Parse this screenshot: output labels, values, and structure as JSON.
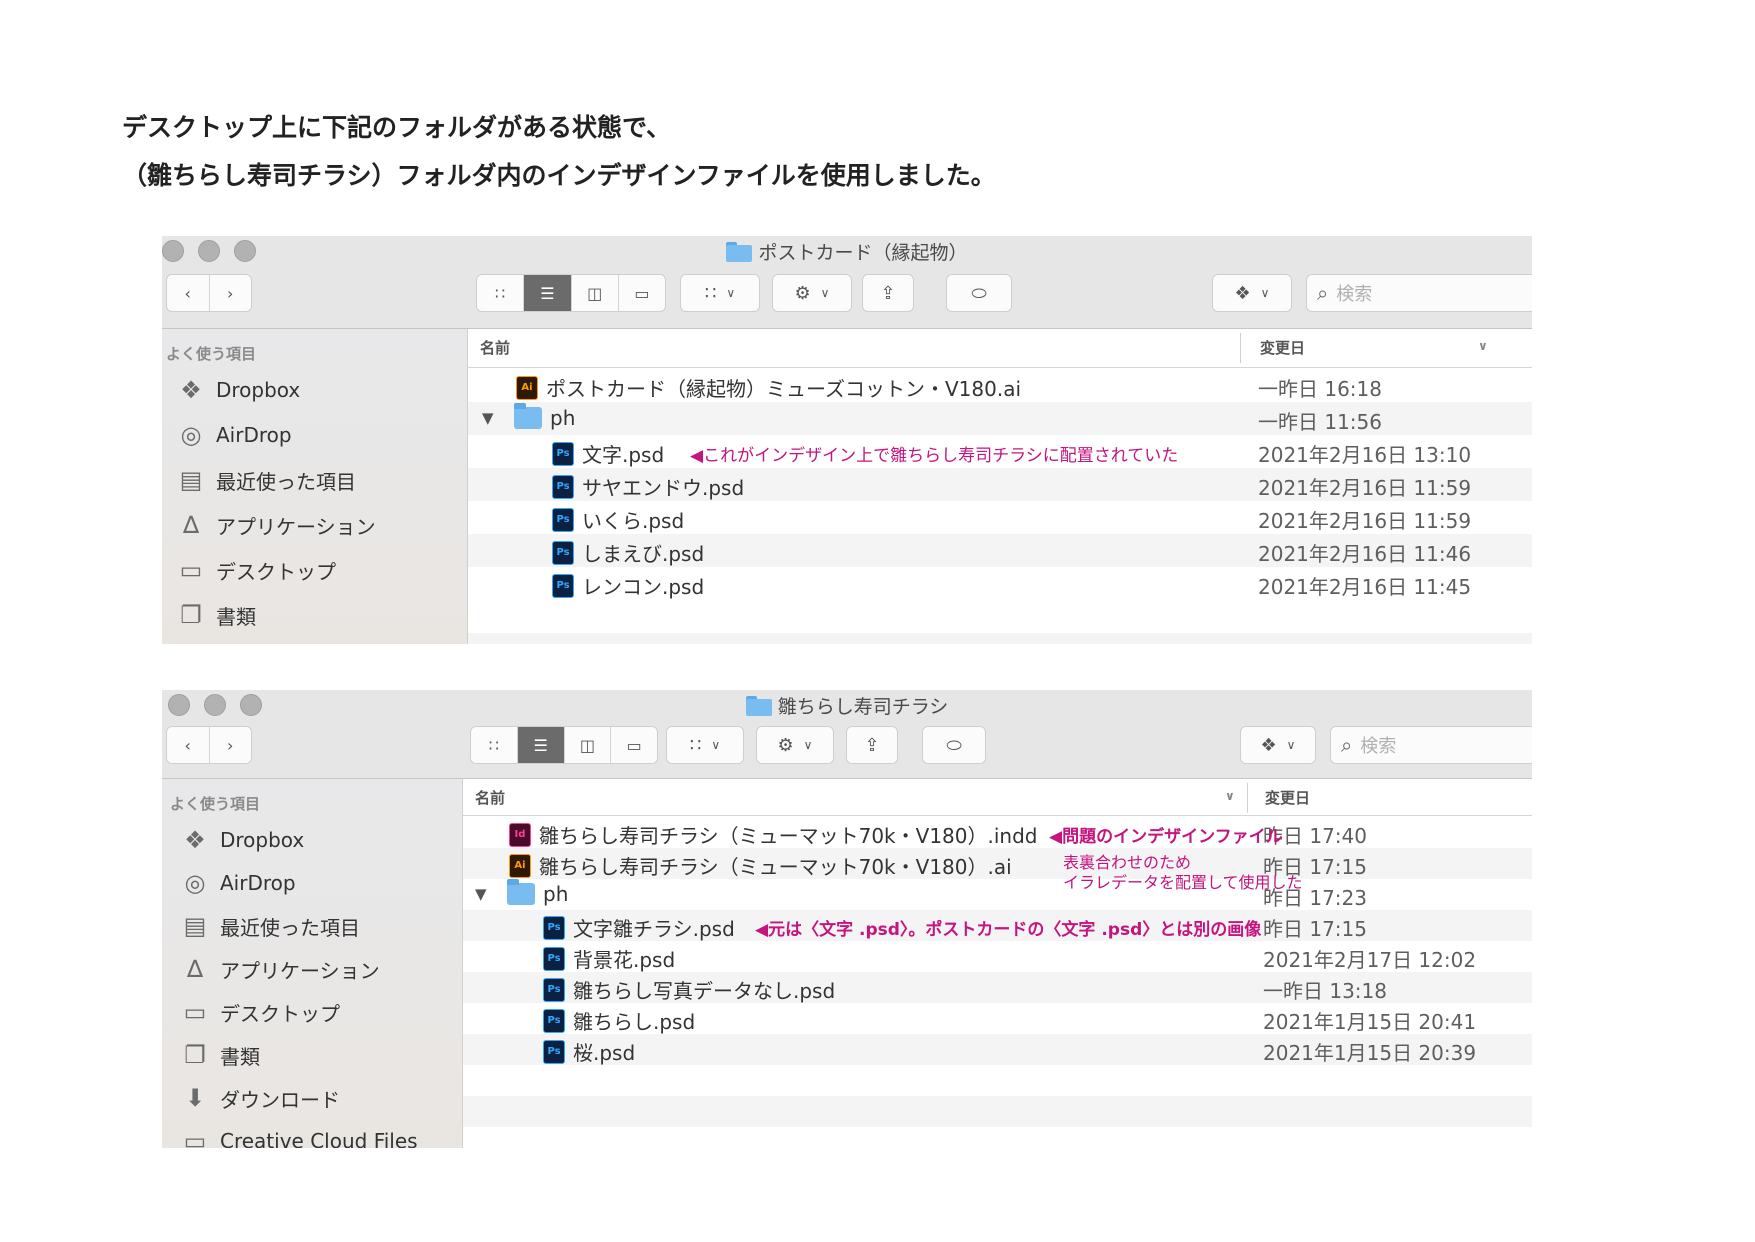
{
  "intro": {
    "line1": "デスクトップ上に下記のフォルダがある状態で、",
    "line2": "（雛ちらし寿司チラシ）フォルダ内のインデザインファイルを使用しました。"
  },
  "colors": {
    "annotation": "#c4147f",
    "folder": "#79bdf0",
    "selected_segment": "#6b6b6b"
  },
  "window1": {
    "title": "ポストカード（縁起物）",
    "search_placeholder": "検索",
    "sidebar_heading": "よく使う項目",
    "sidebar": [
      {
        "label": "Dropbox",
        "icon": "dropbox-icon"
      },
      {
        "label": "AirDrop",
        "icon": "airdrop-icon"
      },
      {
        "label": "最近使った項目",
        "icon": "recents-icon"
      },
      {
        "label": "アプリケーション",
        "icon": "applications-icon"
      },
      {
        "label": "デスクトップ",
        "icon": "desktop-icon"
      },
      {
        "label": "書類",
        "icon": "documents-icon"
      }
    ],
    "col_name": "名前",
    "col_date": "変更日",
    "rows": [
      {
        "name": "ポストカード（縁起物）ミューズコットン・V180.ai",
        "date": "一昨日 16:18",
        "type": "ai",
        "indent": 0
      },
      {
        "name": "ph",
        "date": "一昨日 11:56",
        "type": "folder",
        "indent": 0
      },
      {
        "name": "文字.psd",
        "date": "2021年2月16日 13:10",
        "type": "ps",
        "indent": 1
      },
      {
        "name": "サヤエンドウ.psd",
        "date": "2021年2月16日 11:59",
        "type": "ps",
        "indent": 1
      },
      {
        "name": "いくら.psd",
        "date": "2021年2月16日 11:59",
        "type": "ps",
        "indent": 1
      },
      {
        "name": "しまえび.psd",
        "date": "2021年2月16日 11:46",
        "type": "ps",
        "indent": 1
      },
      {
        "name": "レンコン.psd",
        "date": "2021年2月16日 11:45",
        "type": "ps",
        "indent": 1
      }
    ],
    "annotation": "◀これがインデザイン上で雛ちらし寿司チラシに配置されていた"
  },
  "window2": {
    "title": "雛ちらし寿司チラシ",
    "search_placeholder": "検索",
    "sidebar_heading": "よく使う項目",
    "sidebar": [
      {
        "label": "Dropbox",
        "icon": "dropbox-icon"
      },
      {
        "label": "AirDrop",
        "icon": "airdrop-icon"
      },
      {
        "label": "最近使った項目",
        "icon": "recents-icon"
      },
      {
        "label": "アプリケーション",
        "icon": "applications-icon"
      },
      {
        "label": "デスクトップ",
        "icon": "desktop-icon"
      },
      {
        "label": "書類",
        "icon": "documents-icon"
      },
      {
        "label": "ダウンロード",
        "icon": "downloads-icon"
      },
      {
        "label": "Creative Cloud Files",
        "icon": "folder-icon"
      }
    ],
    "col_name": "名前",
    "col_date": "変更日",
    "rows": [
      {
        "name": "雛ちらし寿司チラシ（ミューマット70k・V180）.indd",
        "date": "昨日 17:40",
        "type": "id",
        "indent": 0
      },
      {
        "name": "雛ちらし寿司チラシ（ミューマット70k・V180）.ai",
        "date": "昨日 17:15",
        "type": "ai",
        "indent": 0
      },
      {
        "name": "ph",
        "date": "昨日 17:23",
        "type": "folder",
        "indent": 0
      },
      {
        "name": "文字雛チラシ.psd",
        "date": "昨日 17:15",
        "type": "ps",
        "indent": 1
      },
      {
        "name": "背景花.psd",
        "date": "2021年2月17日 12:02",
        "type": "ps",
        "indent": 1
      },
      {
        "name": "雛ちらし写真データなし.psd",
        "date": "一昨日 13:18",
        "type": "ps",
        "indent": 1
      },
      {
        "name": "雛ちらし.psd",
        "date": "2021年1月15日 20:41",
        "type": "ps",
        "indent": 1
      },
      {
        "name": "桜.psd",
        "date": "2021年1月15日 20:39",
        "type": "ps",
        "indent": 1
      }
    ],
    "annotation_indd": "◀問題のインデザインファイル",
    "annotation_ai_line1": "表裏合わせのため",
    "annotation_ai_line2": "イラレデータを配置して使用した",
    "annotation_psd": "◀元は〈文字 .psd〉。ポストカードの〈文字 .psd〉とは別の画像"
  }
}
